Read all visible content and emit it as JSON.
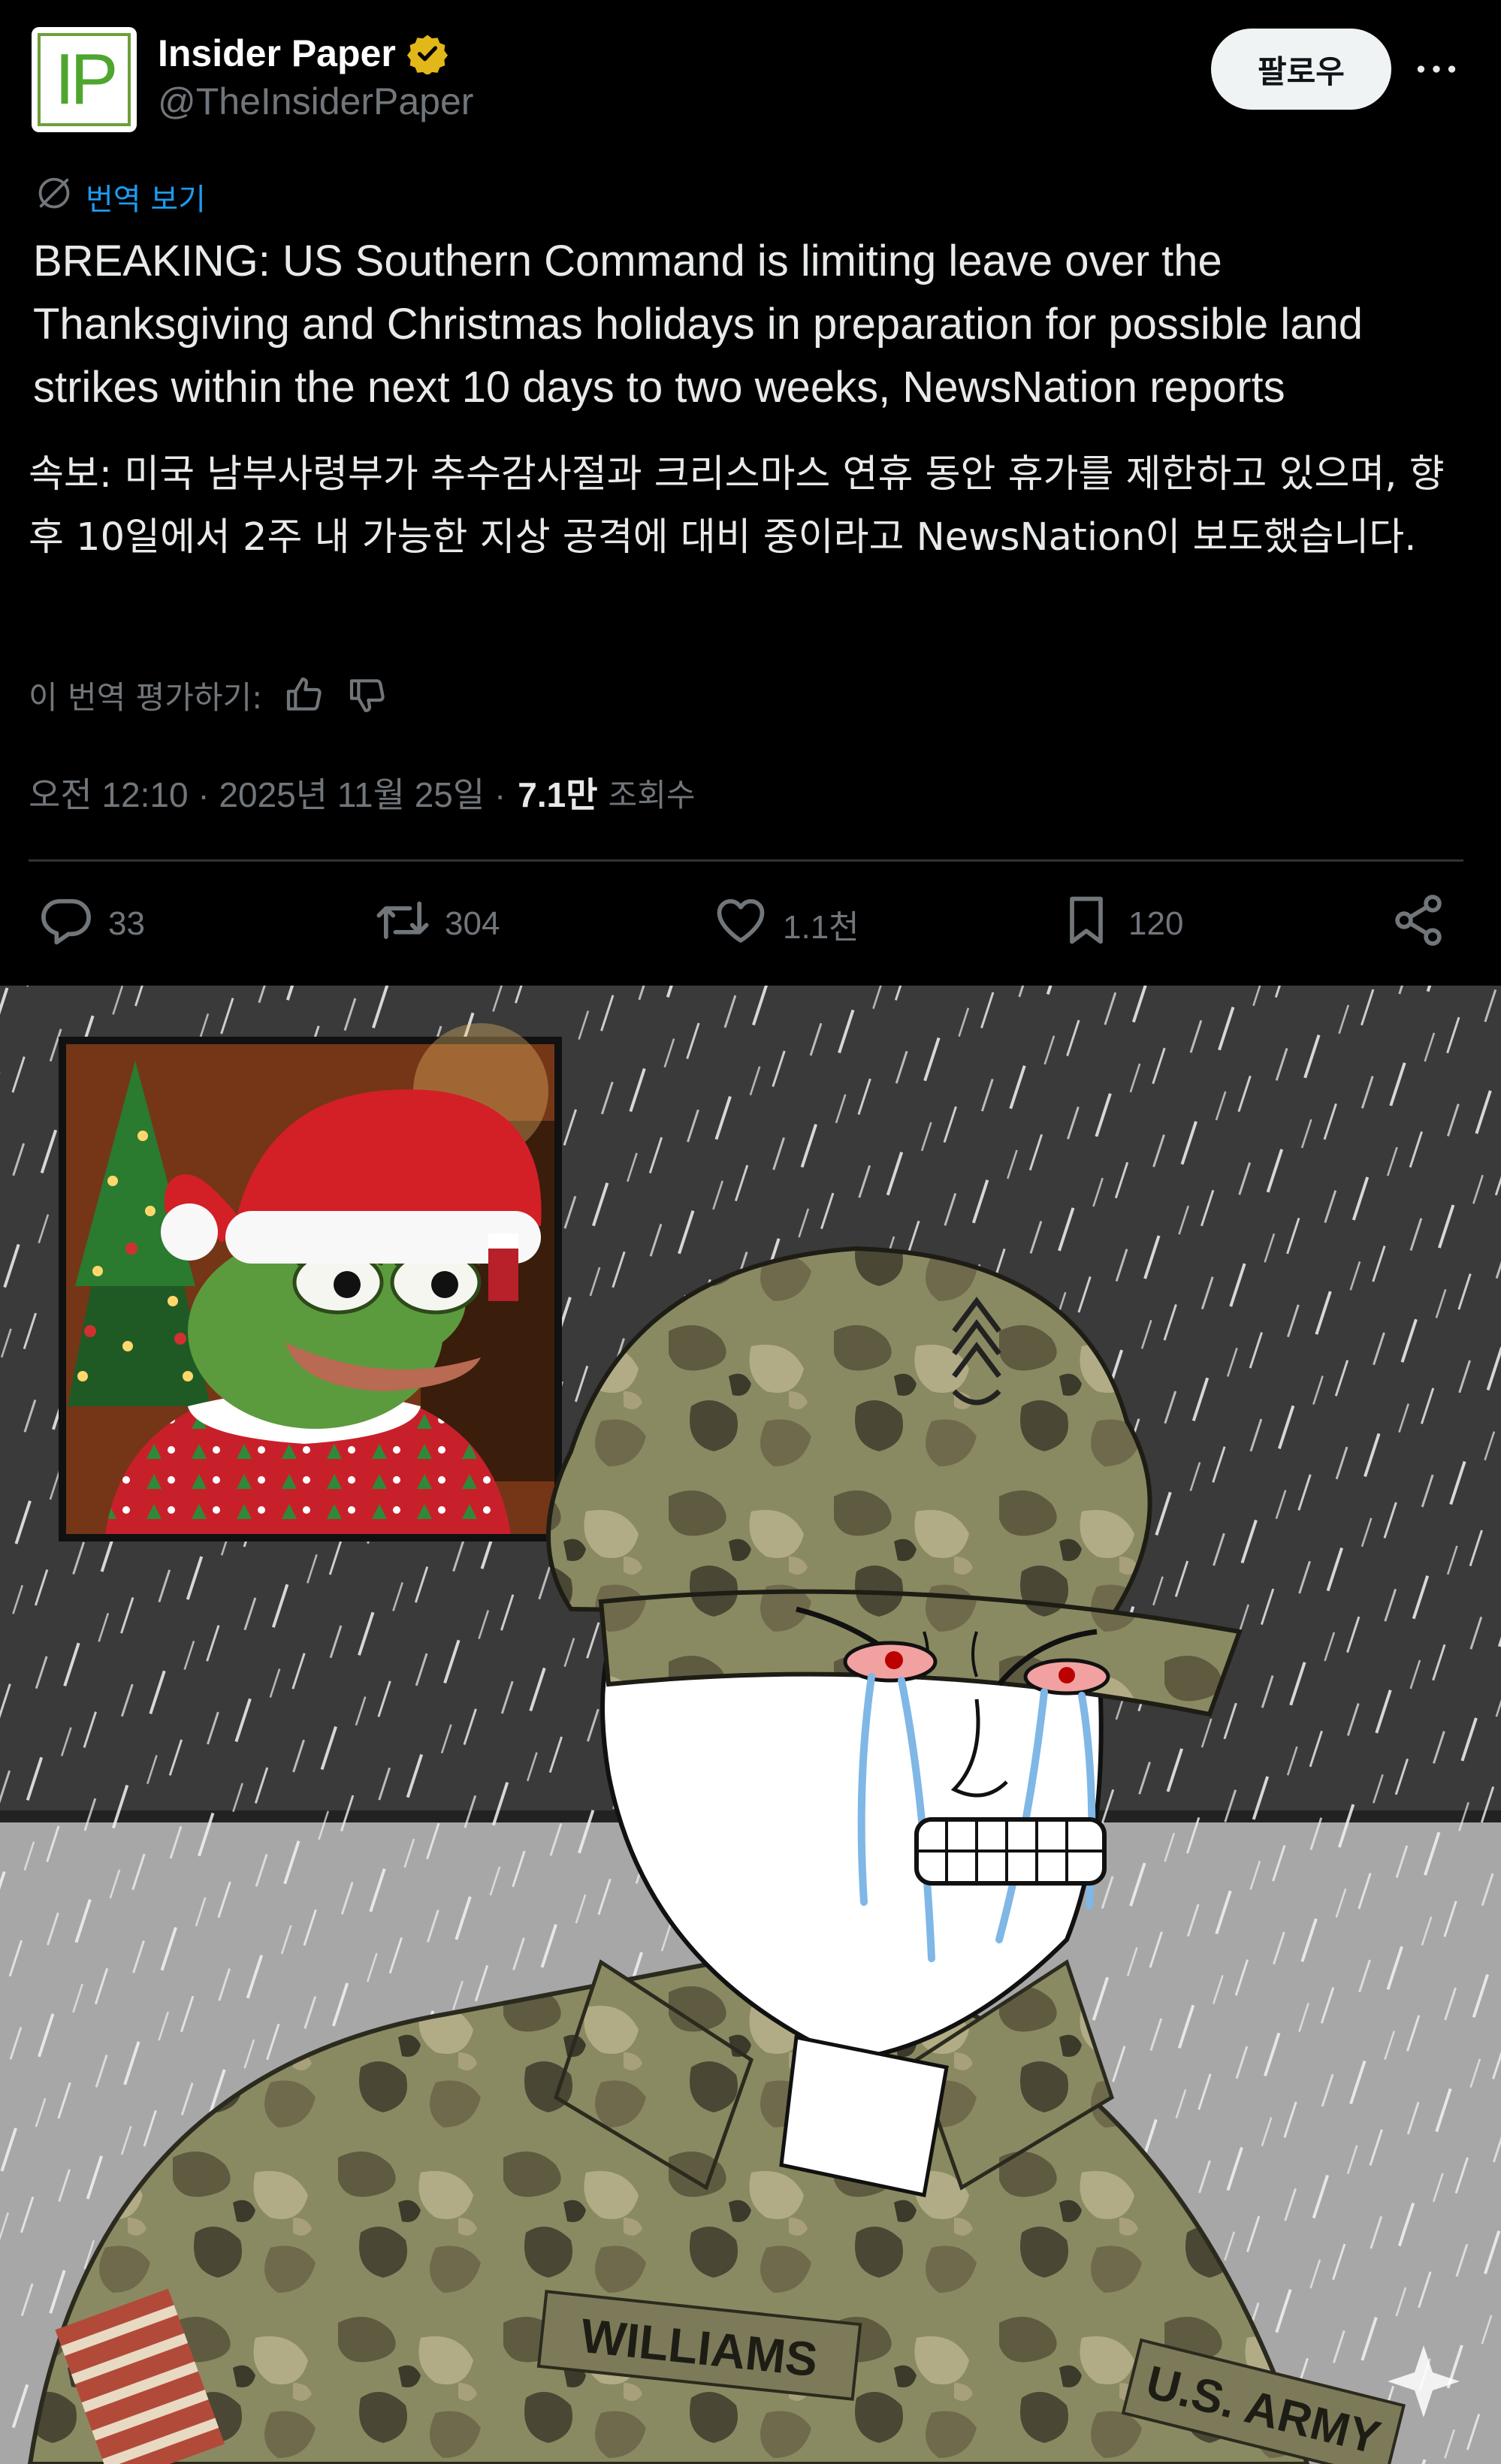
{
  "account": {
    "avatar_text": "IP",
    "name": "Insider Paper",
    "handle": "@TheInsiderPaper",
    "verified_badge_icon": "verified-badge-icon"
  },
  "header": {
    "follow_label": "팔로우",
    "more_icon": "more-dots-icon"
  },
  "tweet": {
    "translate_link": "번역 보기",
    "text": "BREAKING: US Southern Command is limiting leave over the Thanksgiving and Christmas holidays in preparation for possible land strikes within the next 10 days to two weeks, NewsNation reports",
    "translation": "속보: 미국 남부사령부가 추수감사절과 크리스마스 연휴 동안 휴가를 제한하고 있으며, 향후 10일에서 2주 내 가능한 지상 공격에 대비 중이라고 NewsNation이 보도했습니다.",
    "rate_translation_label": "이 번역 평가하기:",
    "timestamp": "오전 12:10 · 2025년 11월 25일 ·",
    "views_count": "7.1만",
    "views_label": "조회수"
  },
  "actions": {
    "replies": "33",
    "retweets": "304",
    "likes": "1.1천",
    "bookmarks": "120"
  },
  "media": {
    "nametape": "WILLIAMS",
    "branch_tape": "U.S. ARMY"
  },
  "colors": {
    "background": "#000000",
    "text": "#e7e9ea",
    "muted": "#71767b",
    "link": "#1d9bf0",
    "verified": "#e2b719",
    "follow_bg": "#eff3f4"
  }
}
